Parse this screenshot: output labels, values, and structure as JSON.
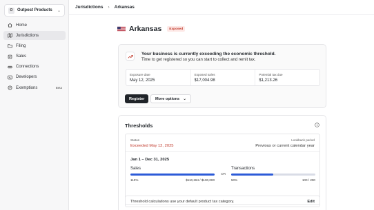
{
  "sidebar": {
    "org": {
      "initial": "O",
      "name": "Outpost Products"
    },
    "items": [
      {
        "label": "Home",
        "icon": "home-icon",
        "active": false
      },
      {
        "label": "Jurisdictions",
        "icon": "map-icon",
        "active": true
      },
      {
        "label": "Filing",
        "icon": "folder-icon",
        "active": false
      },
      {
        "label": "Sales",
        "icon": "receipt-icon",
        "active": false
      },
      {
        "label": "Connections",
        "icon": "link-icon",
        "active": false
      },
      {
        "label": "Developers",
        "icon": "code-icon",
        "active": false
      },
      {
        "label": "Exemptions",
        "icon": "badge-icon",
        "active": false,
        "badge": "Beta"
      }
    ]
  },
  "breadcrumb": {
    "parent": "Jurisdictions",
    "separator": "›",
    "current": "Arkansas"
  },
  "page": {
    "title": "Arkansas",
    "status_badge": "Exposed",
    "flag_icon": "us-flag-icon"
  },
  "alert": {
    "title": "Your business is currently exceeding the economic threshold.",
    "subtitle": "Time to get registered so you can start to collect and remit tax.",
    "stats": [
      {
        "label": "Exposure date",
        "value": "May 12, 2025"
      },
      {
        "label": "Exposed sales",
        "value": "$17,004.98"
      },
      {
        "label": "Potential tax due",
        "value": "$1,213.26"
      }
    ],
    "register_label": "Register",
    "more_options_label": "More options"
  },
  "thresholds": {
    "title": "Thresholds",
    "status_label": "Status",
    "status_value": "Exceeded May 12, 2025",
    "lookback_label": "Lookback period",
    "lookback_value": "Previous or current calendar year",
    "period": "Jan 1 – Dec 31, 2025",
    "or_label": "OR",
    "sales": {
      "label": "Sales",
      "percent_text": "110%",
      "progress": 1.0,
      "amount_text": "$110,264 / $100,000"
    },
    "transactions": {
      "label": "Transactions",
      "percent_text": "50%",
      "progress": 0.5,
      "count_text": "100 / 200"
    },
    "footer_text": "Threshold calculations use your default product tax category.",
    "edit_label": "Edit"
  },
  "colors": {
    "accent": "#2c5bd8",
    "danger": "#c0392b",
    "badge_bg": "#fde8e6",
    "primary_button": "#1f2328"
  }
}
